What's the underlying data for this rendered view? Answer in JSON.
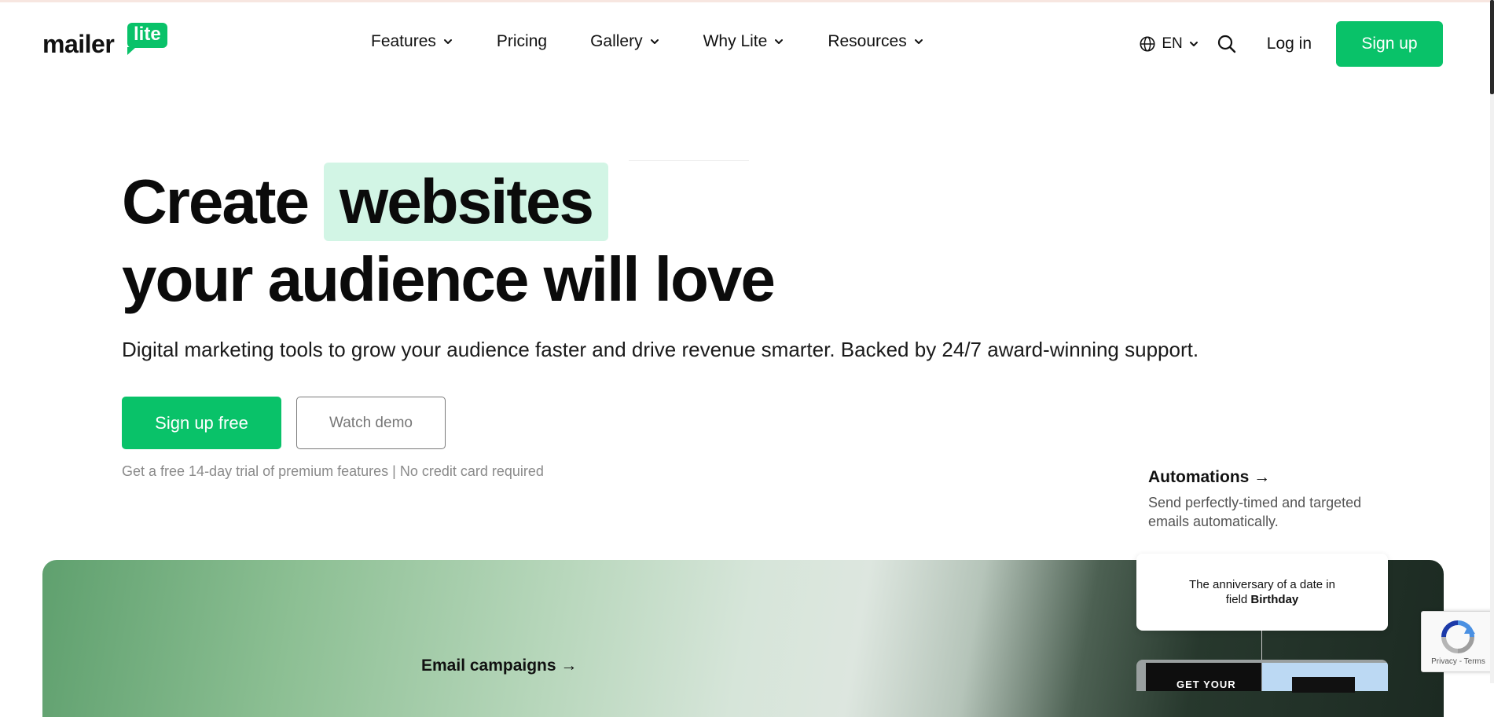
{
  "brand": {
    "logo_word": "mailer",
    "logo_badge": "lite",
    "accent": "#09c269",
    "highlight": "#d2f5e5"
  },
  "nav": {
    "items": [
      {
        "label": "Features",
        "has_dropdown": true
      },
      {
        "label": "Pricing",
        "has_dropdown": false
      },
      {
        "label": "Gallery",
        "has_dropdown": true
      },
      {
        "label": "Why Lite",
        "has_dropdown": true
      },
      {
        "label": "Resources",
        "has_dropdown": true
      }
    ]
  },
  "header_tools": {
    "language": "EN",
    "login_label": "Log in",
    "signup_label": "Sign up"
  },
  "hero": {
    "line1_word": "Create",
    "line1_highlight": "websites",
    "line2": "your audience will love",
    "subtitle": "Digital marketing tools to grow your audience faster and drive revenue smarter. Backed by 24/7 award-winning support.",
    "cta_primary": "Sign up free",
    "cta_secondary": "Watch demo",
    "trial_note": "Get a free 14-day trial of premium features | No credit card required"
  },
  "features": {
    "automations": {
      "title": "Automations →",
      "description": "Send perfectly-timed and targeted emails automatically.",
      "card_text": "The anniversary of a date in",
      "card_field_prefix": "field ",
      "card_field_name": "Birthday",
      "preview_text": "GET YOUR"
    },
    "email_campaigns": {
      "title": "Email campaigns →"
    }
  },
  "recaptcha": {
    "text": "Privacy - Terms"
  }
}
